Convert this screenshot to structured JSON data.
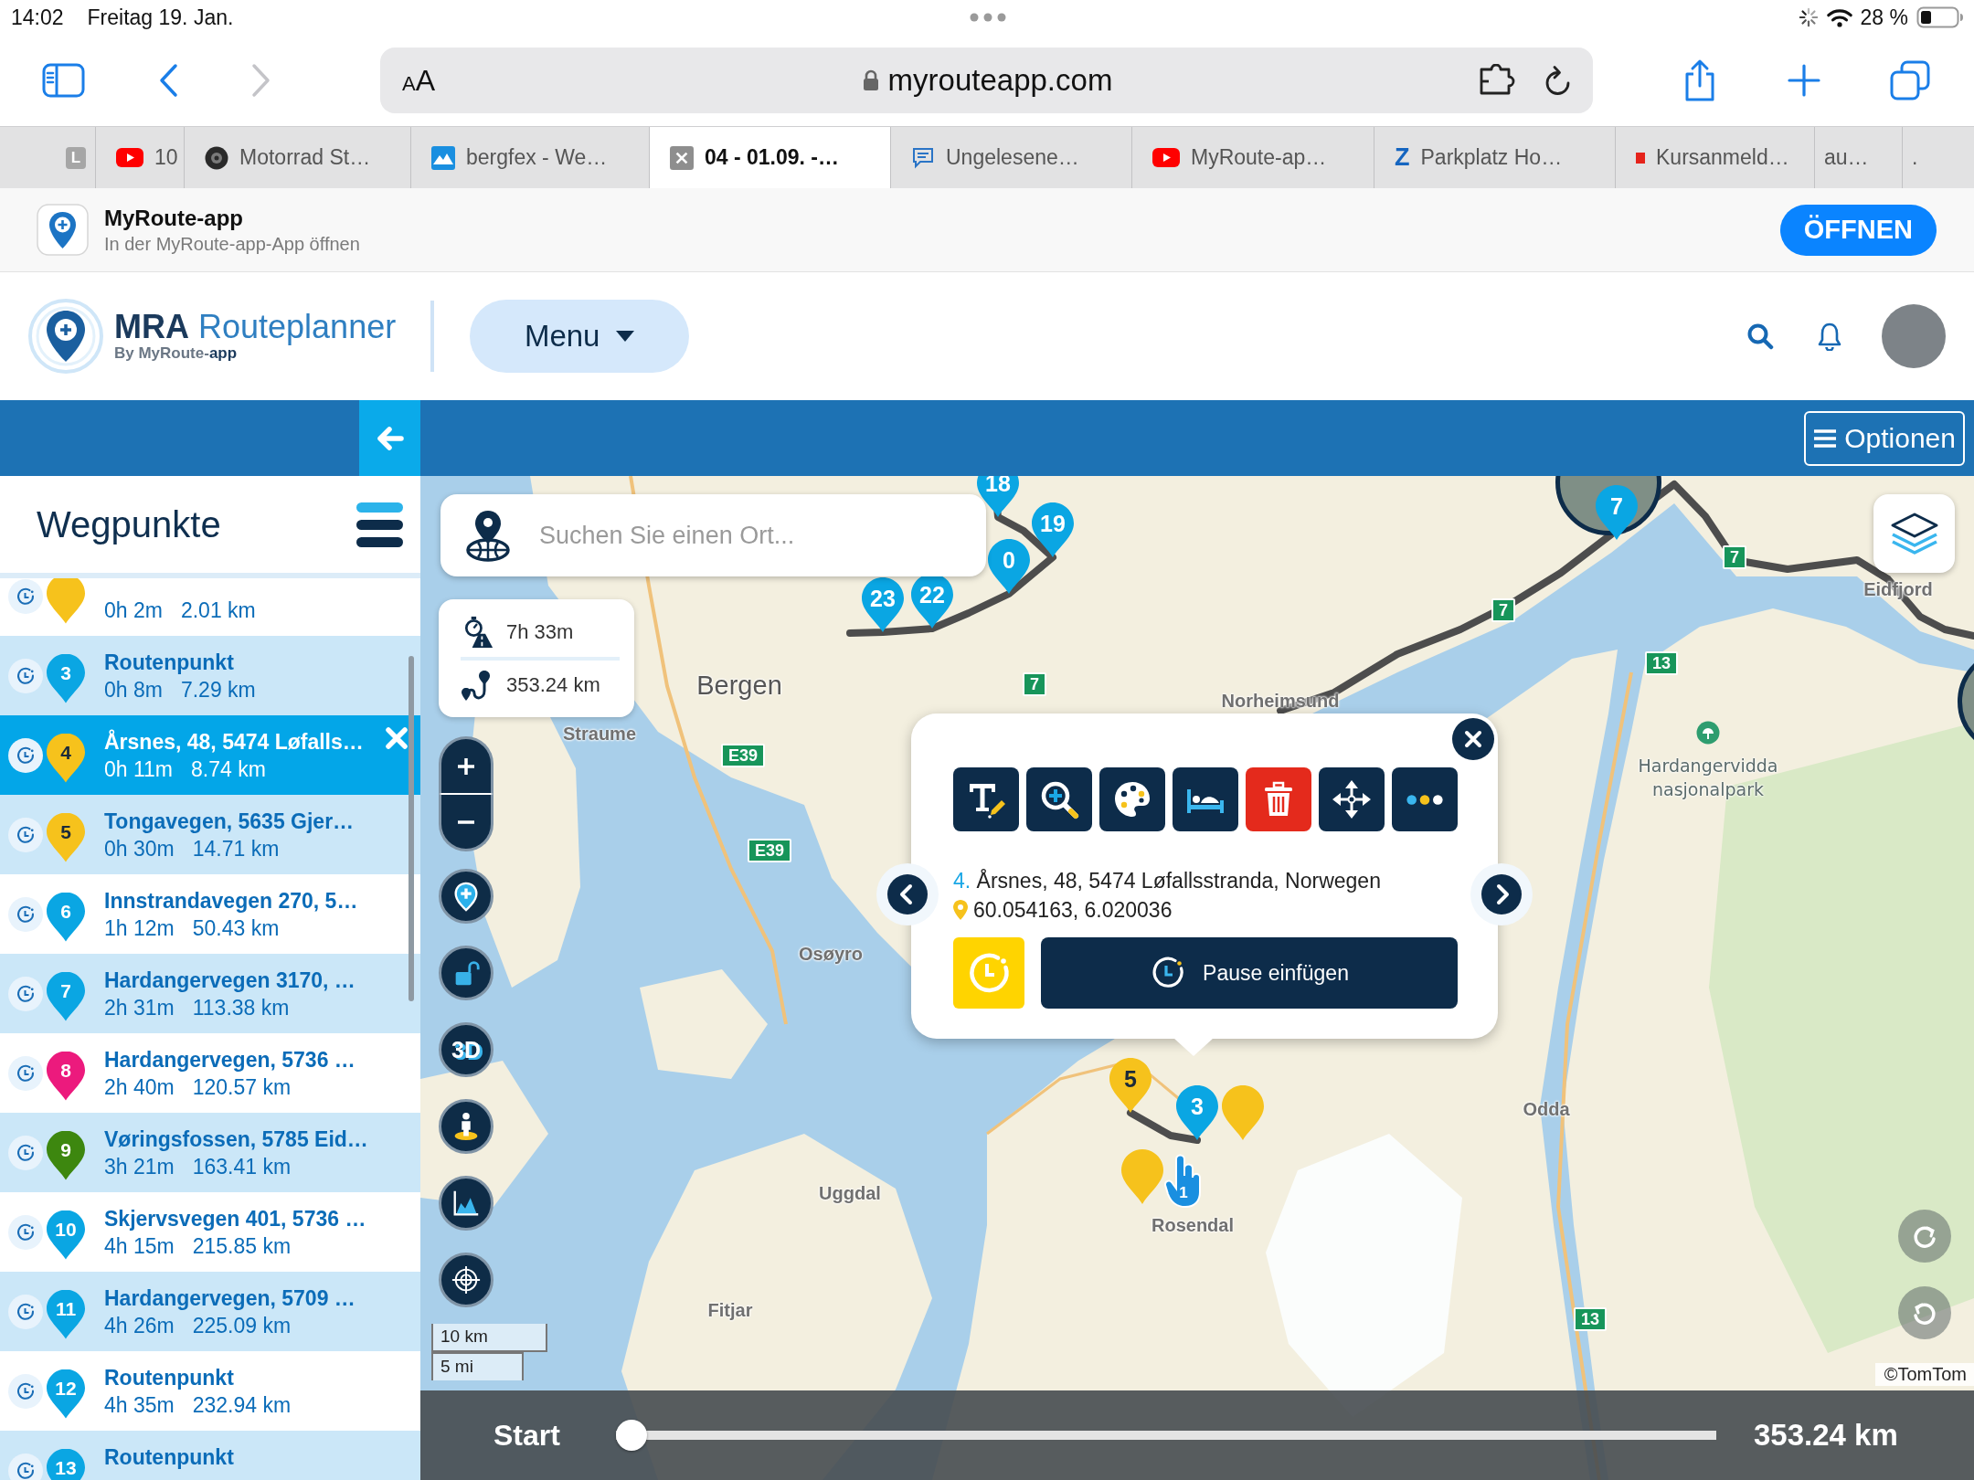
{
  "status_bar": {
    "time": "14:02",
    "date": "Freitag 19. Jan.",
    "battery": "28 %"
  },
  "browser": {
    "nav": [
      {
        "kind": "back",
        "disabled": false
      },
      {
        "kind": "forward",
        "disabled": true
      }
    ],
    "reader": "AA",
    "url": "myrouteapp.com"
  },
  "tabs": [
    {
      "kind": "letter-square",
      "icon_text": "L",
      "selected": false
    },
    {
      "kind": "video",
      "title": "10",
      "selected": false
    },
    {
      "kind": "emblem",
      "title": "Motorrad St…",
      "selected": false
    },
    {
      "kind": "mountain",
      "title": "bergfex - We…",
      "selected": false
    },
    {
      "kind": "close",
      "title": "04 - 01.09. -…",
      "selected": true
    },
    {
      "kind": "message",
      "title": "Ungelesene…",
      "selected": false
    },
    {
      "kind": "video",
      "title": "MyRoute-ap…",
      "selected": false
    },
    {
      "kind": "letter",
      "icon_text": "Z",
      "title": "Parkplatz Ho…",
      "selected": false
    },
    {
      "kind": "mark",
      "title": "Kursanmeld…",
      "selected": false
    },
    {
      "kind": "plain",
      "title": "au…",
      "selected": false
    },
    {
      "kind": "plain",
      "title": ".",
      "selected": false
    }
  ],
  "app_banner": {
    "title": "MyRoute-app",
    "subtitle": "In der MyRoute-app-App öffnen",
    "button": "ÖFFNEN"
  },
  "header": {
    "brand_bold": "MRA",
    "brand_light": "Routeplanner",
    "tagline": "By MyRoute-**app**",
    "menu": "Menu"
  },
  "toolbar": {
    "options": "Optionen"
  },
  "sidebar": {
    "title": "Wegpunkte",
    "waypoints": [
      {
        "time": "0h 2m",
        "distance": "2.01 km",
        "color": "#f6c21c",
        "selected": false
      },
      {
        "number": "3",
        "name": "Routenpunkt",
        "time": "0h 8m",
        "distance": "7.29 km",
        "color": "#0aa6e3",
        "selected": false
      },
      {
        "number": "4",
        "name": "Årsnes, 48, 5474 Løfalls…",
        "time": "0h 11m",
        "distance": "8.74 km",
        "color": "#f6c21c",
        "selected": true
      },
      {
        "number": "5",
        "name": "Tongavegen, 5635 Gjer…",
        "time": "0h 30m",
        "distance": "14.71 km",
        "color": "#f6c21c",
        "selected": false
      },
      {
        "number": "6",
        "name": "Innstrandavegen 270, 5…",
        "time": "1h 12m",
        "distance": "50.43 km",
        "color": "#0aa6e3",
        "selected": false
      },
      {
        "number": "7",
        "name": "Hardangervegen 3170, …",
        "time": "2h 31m",
        "distance": "113.38 km",
        "color": "#0aa6e3",
        "selected": false
      },
      {
        "number": "8",
        "name": "Hardangervegen, 5736 …",
        "time": "2h 40m",
        "distance": "120.57 km",
        "color": "#ec1a7d",
        "selected": false
      },
      {
        "number": "9",
        "name": "Vøringsfossen, 5785 Eid…",
        "time": "3h 21m",
        "distance": "163.41 km",
        "color": "#3d870f",
        "selected": false
      },
      {
        "number": "10",
        "name": "Skjervsvegen 401, 5736 …",
        "time": "4h 15m",
        "distance": "215.85 km",
        "color": "#0aa6e3",
        "selected": false
      },
      {
        "number": "11",
        "name": "Hardangervegen, 5709 …",
        "time": "4h 26m",
        "distance": "225.09 km",
        "color": "#0aa6e3",
        "selected": false
      },
      {
        "number": "12",
        "name": "Routenpunkt",
        "time": "4h 35m",
        "distance": "232.94 km",
        "color": "#0aa6e3",
        "selected": false
      },
      {
        "number": "13",
        "name": "Routenpunkt",
        "color": "#0aa6e3",
        "selected": false
      }
    ]
  },
  "map": {
    "search_placeholder": "Suchen Sie einen Ort...",
    "duration": "7h 33m",
    "distance": "353.24 km",
    "buttons": [
      {
        "kind": "add-pin"
      },
      {
        "kind": "lock"
      },
      {
        "kind": "three-d",
        "label": "3D"
      },
      {
        "kind": "street-view"
      },
      {
        "kind": "elevation"
      },
      {
        "kind": "locate"
      }
    ],
    "scale": [
      "10 km",
      "5 mi"
    ],
    "places": [
      {
        "name": "Bergen",
        "kind": "city"
      },
      {
        "name": "Straume",
        "kind": "town"
      },
      {
        "name": "Norheimsund",
        "kind": "town"
      },
      {
        "name": "Eidfjord",
        "kind": "town"
      },
      {
        "name": "Hardangervidda nasjonalpark",
        "kind": "park"
      },
      {
        "name": "Osøyro",
        "kind": "town"
      },
      {
        "name": "Odda",
        "kind": "town"
      },
      {
        "name": "Rosendal",
        "kind": "town"
      },
      {
        "name": "Uggdal",
        "kind": "town"
      },
      {
        "name": "Fitjar",
        "kind": "town"
      }
    ],
    "roads": [
      "7",
      "7",
      "13",
      "7",
      "E39",
      "E39",
      "13"
    ],
    "markers": [
      {
        "kind": "pin",
        "label": "18",
        "color": "#0aa6e3"
      },
      {
        "kind": "photo",
        "label": "7",
        "color": "#0aa6e3"
      },
      {
        "kind": "pin",
        "label": "19",
        "color": "#0aa6e3"
      },
      {
        "kind": "pin",
        "label": "0",
        "color": "#0aa6e3"
      },
      {
        "kind": "pin",
        "label": "22",
        "color": "#0aa6e3"
      },
      {
        "kind": "pin",
        "label": "23",
        "color": "#0aa6e3"
      },
      {
        "kind": "photo"
      },
      {
        "kind": "pin",
        "label": "5",
        "color": "#f6c21c"
      },
      {
        "kind": "pin",
        "color": "#f6c21c"
      },
      {
        "kind": "pin",
        "label": "3",
        "color": "#0aa6e3"
      },
      {
        "kind": "pin",
        "color": "#f6c21c"
      },
      {
        "kind": "hand",
        "label": "1",
        "color": "#1a8fe0"
      }
    ],
    "attribution": "©TomTom"
  },
  "popup": {
    "tools": [
      {
        "kind": "rename"
      },
      {
        "kind": "zoom"
      },
      {
        "kind": "style"
      },
      {
        "kind": "overnight"
      },
      {
        "kind": "delete"
      },
      {
        "kind": "move"
      },
      {
        "kind": "more"
      }
    ],
    "number": "4.",
    "address": "Årsnes, 48, 5474 Løfallsstranda, Norwegen",
    "coordinates": "60.054163, 6.020036",
    "pause_button": "Pause einfügen"
  },
  "route_bar": {
    "start": "Start",
    "level": 0,
    "total": "353.24 km"
  }
}
